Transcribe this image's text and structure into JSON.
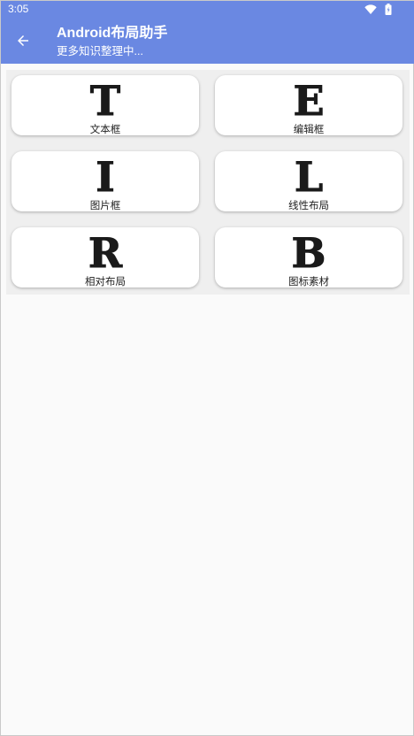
{
  "status_bar": {
    "time": "3:05",
    "icons": [
      "wifi-icon",
      "battery-icon"
    ]
  },
  "app_bar": {
    "title": "Android布局助手",
    "subtitle": "更多知识整理中...",
    "back_icon": "arrow-left-icon"
  },
  "colors": {
    "accent": "#6a88e2",
    "card": "#ffffff",
    "background": "#fafafa"
  },
  "cards": [
    {
      "letter": "T",
      "label": "文本框"
    },
    {
      "letter": "E",
      "label": "编辑框"
    },
    {
      "letter": "I",
      "label": "图片框"
    },
    {
      "letter": "L",
      "label": "线性布局"
    },
    {
      "letter": "R",
      "label": "相对布局"
    },
    {
      "letter": "B",
      "label": "图标素材"
    }
  ]
}
